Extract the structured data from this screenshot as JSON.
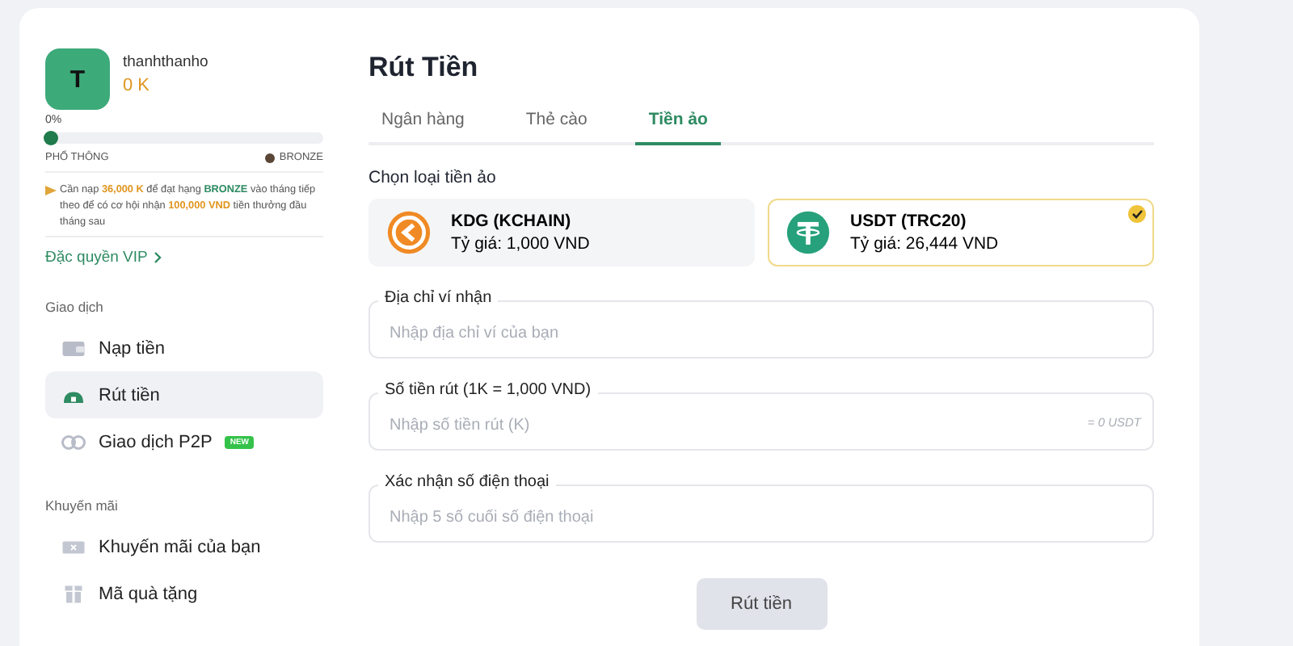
{
  "profile": {
    "avatar_letter": "T",
    "username": "thanhthanho",
    "balance": "0 K",
    "progress_label": "0%",
    "level": 0,
    "rank_from": "PHỔ THÔNG",
    "rank_to": "BRONZE"
  },
  "notice": [
    {
      "kind": "plain",
      "text": "Cần nạp "
    },
    {
      "kind": "amount",
      "text": "36,000 K"
    },
    {
      "kind": "plain",
      "text": " để đạt hạng "
    },
    {
      "kind": "rank",
      "text": "BRONZE"
    },
    {
      "kind": "plain",
      "text": " vào tháng tiếp theo để có cơ hội nhận "
    },
    {
      "kind": "amount",
      "text": "100,000 VND"
    },
    {
      "kind": "plain",
      "text": " tiền thưởng đầu tháng sau"
    }
  ],
  "vip_link": "Đặc quyền VIP",
  "sidebar": [
    {
      "title": "Giao dịch",
      "items": [
        {
          "label": "Nạp tiền",
          "kind": "wallet",
          "selected": false
        },
        {
          "label": "Rút tiền",
          "kind": "withdraw",
          "selected": true
        },
        {
          "label": "Giao dịch P2P",
          "kind": "coins",
          "selected": false,
          "badge": "NEW"
        }
      ]
    },
    {
      "title": "Khuyến mãi",
      "items": [
        {
          "label": "Khuyến mãi của bạn",
          "kind": "ticket",
          "selected": false
        },
        {
          "label": "Mã quà tặng",
          "kind": "gift",
          "selected": false
        }
      ]
    }
  ],
  "page_title": "Rút Tiền",
  "tabs": [
    {
      "label": "Ngân hàng",
      "selected": false
    },
    {
      "label": "Thẻ cào",
      "selected": false
    },
    {
      "label": "Tiền ảo",
      "selected": true
    }
  ],
  "coin_prompt": "Chọn loại tiền ảo",
  "coins": [
    {
      "kind": "kdg",
      "name": "KDG (KCHAIN)",
      "rate": "Tỷ giá: 1,000 VND",
      "selected": false
    },
    {
      "kind": "usdt",
      "name": "USDT (TRC20)",
      "rate": "Tỷ giá: 26,444 VND",
      "selected": true
    }
  ],
  "fields": [
    {
      "label": "Địa chỉ ví nhận",
      "placeholder": "Nhập địa chỉ ví của bạn"
    },
    {
      "label": "Số tiền rút (1K = 1,000 VND)",
      "placeholder": "Nhập số tiền rút (K)",
      "suffix": "= 0 USDT"
    },
    {
      "label": "Xác nhận số điện thoại",
      "placeholder": "Nhập 5 số cuối số điện thoại"
    }
  ],
  "submit": {
    "label": "Rút tiền",
    "disabled": true
  }
}
